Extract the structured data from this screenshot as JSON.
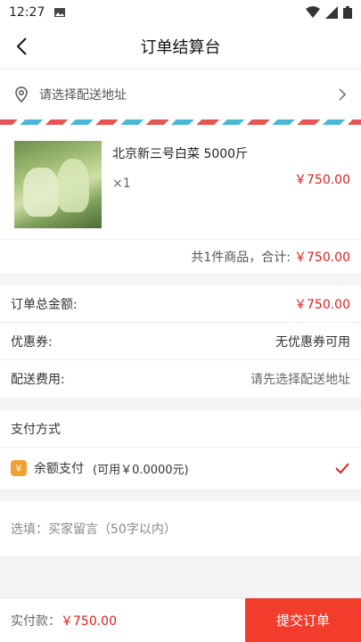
{
  "status": {
    "time": "12:27"
  },
  "header": {
    "title": "订单结算台"
  },
  "address": {
    "placeholder_text": "请选择配送地址"
  },
  "product": {
    "name": "北京新三号白菜 5000斤",
    "quantity": "×1",
    "price": "￥750.00"
  },
  "subtotal": {
    "label": "共1件商品，合计:",
    "amount": "￥750.00"
  },
  "summary": {
    "total_label": "订单总金额:",
    "total_value": "￥750.00",
    "coupon_label": "优惠券:",
    "coupon_value": "无优惠券可用",
    "delivery_label": "配送费用:",
    "delivery_value": "请先选择配送地址"
  },
  "payment": {
    "section_title": "支付方式",
    "icon_glyph": "¥",
    "method_name": "余额支付",
    "method_detail": "(可用￥0.0000元)"
  },
  "note": {
    "placeholder": "选填：买家留言（50字以内）"
  },
  "footer": {
    "total_label": "实付款：",
    "total_amount": "￥750.00",
    "submit_label": "提交订单"
  },
  "colors": {
    "accent": "#e02020",
    "submit_bg": "#f23c2c",
    "wallet_icon": "#f0a030"
  }
}
